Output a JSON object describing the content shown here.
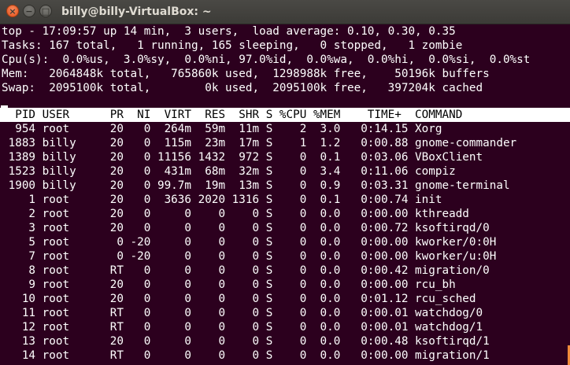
{
  "window": {
    "title": "billy@billy-VirtualBox: ~",
    "buttons": {
      "close": "×",
      "minimize": "−",
      "maximize": "□"
    }
  },
  "summary": {
    "line1": "top - 17:09:57 up 14 min,  3 users,  load average: 0.10, 0.30, 0.35",
    "line2": "Tasks: 167 total,   1 running, 165 sleeping,   0 stopped,   1 zombie",
    "line3": "Cpu(s):  0.0%us,  3.0%sy,  0.0%ni, 97.0%id,  0.0%wa,  0.0%hi,  0.0%si,  0.0%st",
    "line4": "Mem:   2064848k total,   765860k used,  1298988k free,    50196k buffers",
    "line5": "Swap:  2095100k total,        0k used,  2095100k free,   397204k cached"
  },
  "table": {
    "header": "  PID USER      PR  NI  VIRT  RES  SHR S %CPU %MEM    TIME+  COMMAND",
    "rows": [
      "  954 root      20   0  264m  59m  11m S    2  3.0   0:14.15 Xorg",
      " 1883 billy     20   0  115m  23m  17m S    1  1.2   0:00.88 gnome-commander",
      " 1389 billy     20   0 11156 1432  972 S    0  0.1   0:03.06 VBoxClient",
      " 1523 billy     20   0  431m  68m  32m S    0  3.4   0:11.06 compiz",
      " 1900 billy     20   0 99.7m  19m  13m S    0  0.9   0:03.31 gnome-terminal",
      "    1 root      20   0  3636 2020 1316 S    0  0.1   0:00.74 init",
      "    2 root      20   0     0    0    0 S    0  0.0   0:00.00 kthreadd",
      "    3 root      20   0     0    0    0 S    0  0.0   0:00.72 ksoftirqd/0",
      "    5 root       0 -20     0    0    0 S    0  0.0   0:00.00 kworker/0:0H",
      "    7 root       0 -20     0    0    0 S    0  0.0   0:00.00 kworker/u:0H",
      "    8 root      RT   0     0    0    0 S    0  0.0   0:00.42 migration/0",
      "    9 root      20   0     0    0    0 S    0  0.0   0:00.00 rcu_bh",
      "   10 root      20   0     0    0    0 S    0  0.0   0:01.12 rcu_sched",
      "   11 root      RT   0     0    0    0 S    0  0.0   0:00.01 watchdog/0",
      "   12 root      RT   0     0    0    0 S    0  0.0   0:00.01 watchdog/1",
      "   13 root      20   0     0    0    0 S    0  0.0   0:00.48 ksoftirqd/1",
      "   14 root      RT   0     0    0    0 S    0  0.0   0:00.00 migration/1"
    ]
  },
  "colors": {
    "terminal_bg": "#2c001e",
    "terminal_fg": "#ffffff",
    "titlebar_bg": "#3c3b37",
    "close_button": "#e0501c"
  }
}
